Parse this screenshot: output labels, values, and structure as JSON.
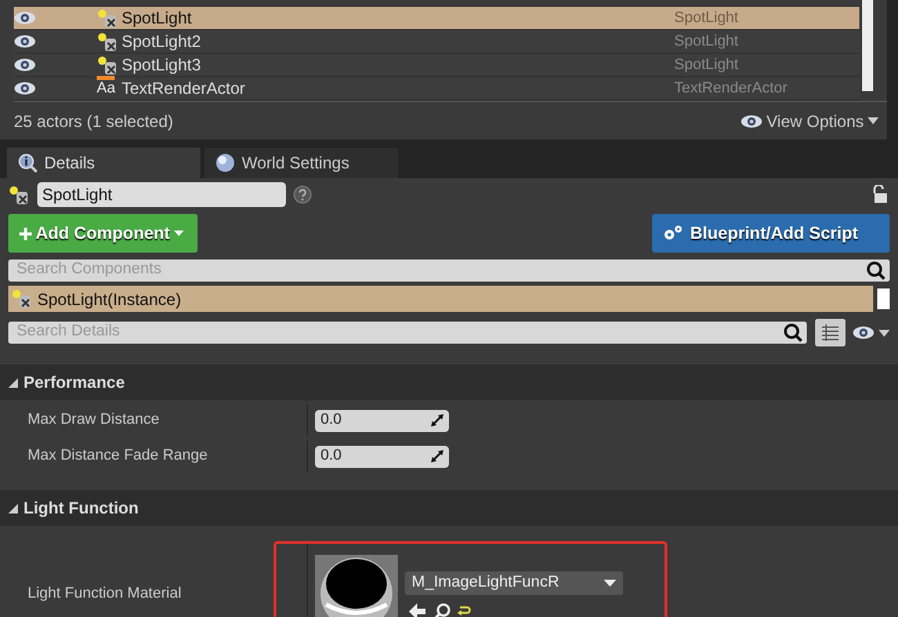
{
  "outliner": {
    "rows": [
      {
        "label": "SpotLight",
        "type": "SpotLight",
        "kind": "spotlight",
        "selected": true
      },
      {
        "label": "SpotLight2",
        "type": "SpotLight",
        "kind": "spotlight",
        "selected": false
      },
      {
        "label": "SpotLight3",
        "type": "SpotLight",
        "kind": "spotlight",
        "selected": false
      },
      {
        "label": "TextRenderActor",
        "type": "TextRenderActor",
        "kind": "text",
        "icon_text": "Aa",
        "selected": false
      }
    ],
    "count": "25 actors (1 selected)",
    "view_options": "View Options"
  },
  "tabs": [
    {
      "label": "Details",
      "selected": true
    },
    {
      "label": "World Settings",
      "selected": false
    }
  ],
  "actor_name": "SpotLight",
  "add_component": "Add Component",
  "blueprint": "Blueprint/Add Script",
  "search_components": {
    "placeholder": "Search Components"
  },
  "component": {
    "label": "SpotLight(Instance)",
    "selected": true
  },
  "search_details": {
    "placeholder": "Search Details"
  },
  "sections": [
    {
      "title": "Performance",
      "expanded": true,
      "rows": [
        {
          "label": "Max Draw Distance",
          "kind": "number",
          "value": "0.0"
        },
        {
          "label": "Max Distance Fade Range",
          "kind": "number",
          "value": "0.0"
        }
      ]
    },
    {
      "title": "Light Function",
      "expanded": true,
      "rows": [
        {
          "label": "Light Function Material",
          "kind": "asset",
          "value": "M_ImageLightFuncR",
          "highlighted": true
        }
      ]
    }
  ]
}
